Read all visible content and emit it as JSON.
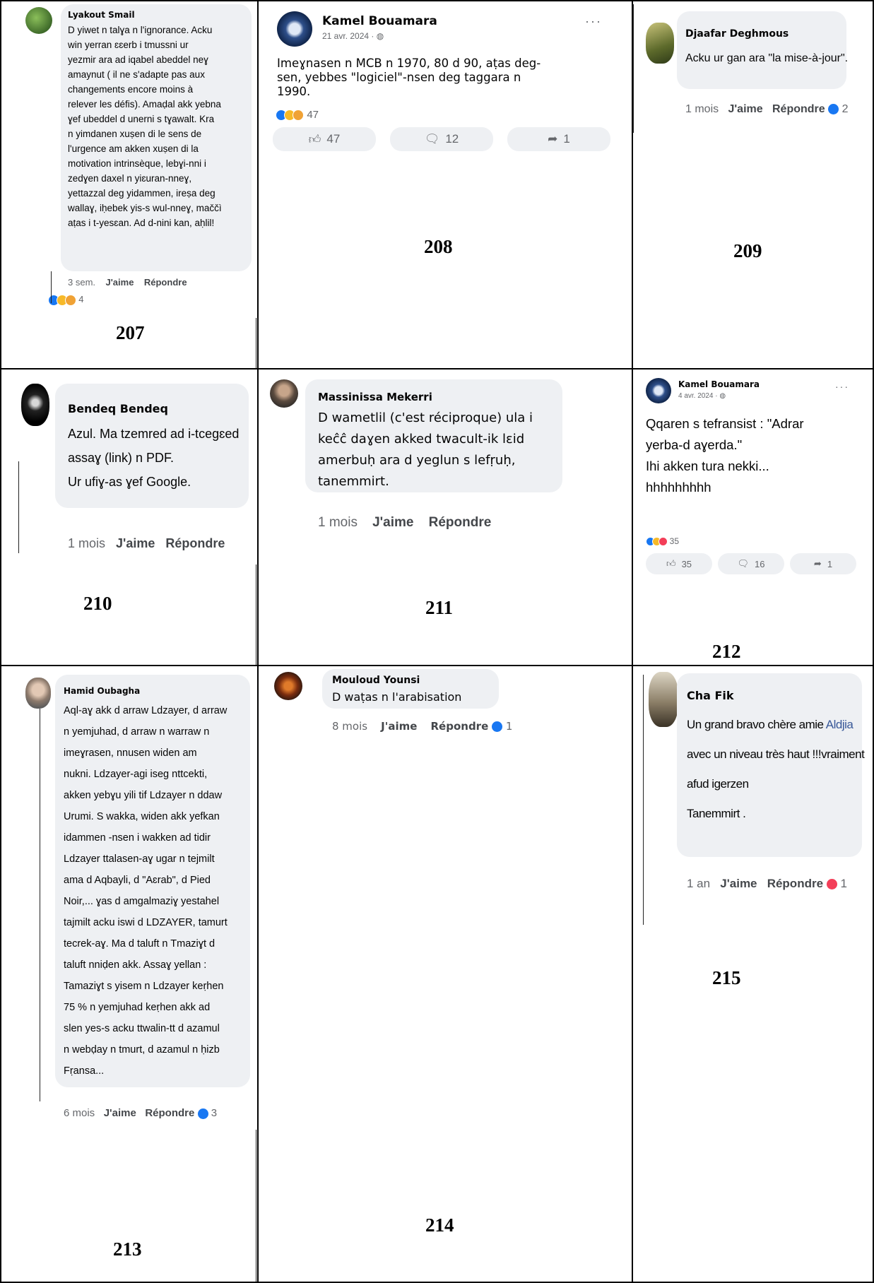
{
  "cells": {
    "c207": {
      "number": "207",
      "author": "Lyakout Smail",
      "lines": [
        "D yiwet n talɣa n l'ignorance. Acku",
        "win yerran ɛɛerb i tmussni ur",
        "yezmir ara ad iqabel abeddel neɣ",
        "amaynut ( il ne s'adapte pas aux",
        "changements encore moins à",
        "relever les défis). Amaḍal akk yebna",
        "ɣef ubeddel d unerni s tɣawalt. Kra",
        "n yimdanen xuṣen di le sens de",
        "l'urgence am akken xuṣen di la",
        "motivation intrinsèque, lebɣi-nni i",
        "zedɣen daxel n yiɛuran-nneɣ,",
        "yettazzal deg yidammen, ireṣa deg",
        "wallaɣ, iḥebek yis-s wul-nneɣ, maččì",
        "aṭas i t-yesɛan. Ad d-nini kan, aḥlil!"
      ],
      "time": "3 sem.",
      "like": "J'aime",
      "reply": "Répondre",
      "count": "4"
    },
    "c208": {
      "number": "208",
      "author": "Kamel Bouamara",
      "date": "21 avr. 2024 · ",
      "more": "···",
      "lines": [
        "Imeɣnasen n MCB n 1970, 80 d 90, aṭas deg-",
        "sen, yebbes \"logiciel\"-nsen deg taggara n",
        "1990."
      ],
      "reaction_count": "47",
      "btn_like": "47",
      "btn_comment": "12",
      "btn_share": "1"
    },
    "c209": {
      "number": "209",
      "author": "Djaafar Deghmous",
      "text": "Acku ur gan ara \"la mise-à-jour\".",
      "time": "1 mois",
      "like": "J'aime",
      "reply": "Répondre",
      "count": "2"
    },
    "c210": {
      "number": "210",
      "author": "Bendeq Bendeq",
      "lines": [
        "Azul. Ma tzemred ad i-tcegɛed",
        "assaɣ (link) n PDF.",
        "Ur ufiɣ-as ɣef Google."
      ],
      "time": "1 mois",
      "like": "J'aime",
      "reply": "Répondre"
    },
    "c211": {
      "number": "211",
      "author": "Massinissa Mekerri",
      "lines": [
        "D wametlil (c'est réciproque) ula i",
        "keĉĉ daɣen akked twacult-ik lɛid",
        "amerbuḥ ara d yeglun s lefṛuḥ,",
        "tanemmirt."
      ],
      "time": "1 mois",
      "like": "J'aime",
      "reply": "Répondre"
    },
    "c212": {
      "number": "212",
      "author": "Kamel Bouamara",
      "date": "4 avr. 2024 · ",
      "more": "···",
      "lines": [
        "Qqaren s tefransist : \"Adrar",
        "yerba-d aɣerda.\"",
        "Ihi akken tura nekki...",
        "hhhhhhhhh"
      ],
      "reaction_count": "35",
      "btn_like": "35",
      "btn_comment": "16",
      "btn_share": "1"
    },
    "c213": {
      "number": "213",
      "author": "Hamid Oubagha",
      "lines": [
        "Aql-aɣ akk d arraw Ldzayer, d arraw",
        "n yemjuhad, d arraw n warraw n",
        "imeɣrasen, nnusen widen am",
        "nukni. Ldzayer-agi iseg nttcekti,",
        "akken yebɣu yili tif Ldzayer n ddaw",
        "Urumi. S wakka, widen akk yefkan",
        "idammen -nsen i wakken ad tidir",
        "Ldzayer ttalasen-aɣ ugar n tejmilt",
        "ama d Aqbayli, d \"Aɛrab\", d Pied",
        "Noir,... ɣas d amgalmaziɣ yestahel",
        "tajmilt acku iswi d LDZAYER, tamurt",
        "tecrek-aɣ. Ma d taluft n Tmaziɣt d",
        "taluft nniḍen akk. Assaɣ yellan :",
        "Tamaziɣt s yisem n Ldzayer keṛhen",
        "75 % n yemjuhad keṛhen akk ad",
        "slen yes-s acku ttwalin-tt d azamul",
        "n webḍay n tmurt, d azamul n ḥizb",
        "Fṛansa..."
      ],
      "time": "6 mois",
      "like": "J'aime",
      "reply": "Répondre",
      "count": "3"
    },
    "c214": {
      "number": "214",
      "author": "Mouloud Younsi",
      "text": "D waṭas n l'arabisation",
      "time": "8 mois",
      "like": "J'aime",
      "reply": "Répondre",
      "count": "1"
    },
    "c215": {
      "number": "215",
      "author": "Cha Fik",
      "text_before": "Un grand bravo chère amie ",
      "mention": "Aldjia",
      "lines_after": [
        "avec un niveau très haut !!!vraiment",
        "afud igerzen",
        "Tanemmirt ."
      ],
      "time": "1 an",
      "like": "J'aime",
      "reply": "Répondre",
      "count": "1"
    }
  },
  "colors": {
    "like_blue": "#1877f2",
    "love_red": "#f33e58",
    "haha_yellow": "#f7b928",
    "mention_blue": "#385898",
    "bubble_gray": "#eef0f3"
  }
}
